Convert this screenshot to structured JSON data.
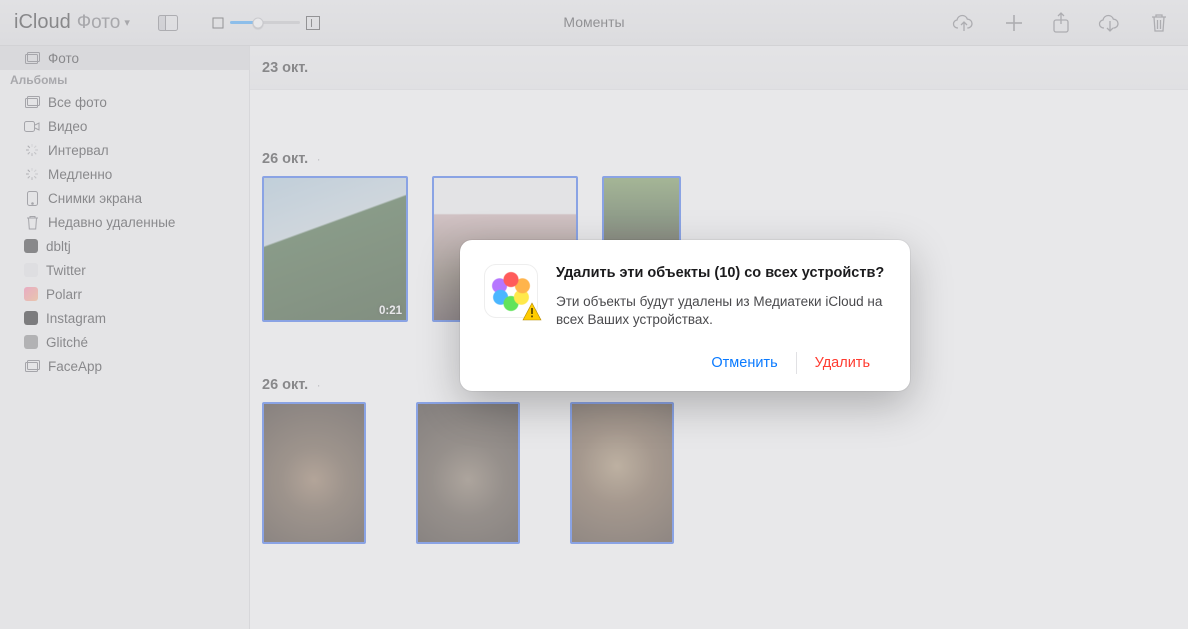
{
  "toolbar": {
    "app_name": "iCloud",
    "section": "Фото",
    "title": "Моменты",
    "zoom_percent": 40
  },
  "sidebar": {
    "top": {
      "label": "Фото"
    },
    "albums_header": "Альбомы",
    "items": [
      {
        "label": "Все фото",
        "icon": "stack"
      },
      {
        "label": "Видео",
        "icon": "video"
      },
      {
        "label": "Интервал",
        "icon": "spinner"
      },
      {
        "label": "Медленно",
        "icon": "spinner"
      },
      {
        "label": "Снимки экрана",
        "icon": "device"
      },
      {
        "label": "Недавно удаленные",
        "icon": "trash"
      },
      {
        "label": "dbltj",
        "icon": "thumb",
        "tone": "dark"
      },
      {
        "label": "Twitter",
        "icon": "thumb",
        "tone": "light"
      },
      {
        "label": "Polarr",
        "icon": "thumb",
        "tone": "pink"
      },
      {
        "label": "Instagram",
        "icon": "thumb",
        "tone": "black"
      },
      {
        "label": "Glitché",
        "icon": "thumb",
        "tone": "grey"
      },
      {
        "label": "FaceApp",
        "icon": "stack"
      }
    ]
  },
  "sections": [
    {
      "date": "23 окт."
    },
    {
      "date": "26 окт.",
      "marker": "·",
      "thumbs": [
        {
          "kind": "tree",
          "size": "t150",
          "duration": "0:21"
        },
        {
          "kind": "closet",
          "size": "t150"
        },
        {
          "kind": "garden",
          "size": "t80"
        }
      ]
    },
    {
      "date": "26 окт.",
      "marker": "·",
      "thumbs": [
        {
          "kind": "cat1",
          "size": "tport"
        },
        {
          "kind": "cat2",
          "size": "tport"
        },
        {
          "kind": "cat3",
          "size": "tport"
        }
      ]
    }
  ],
  "dialog": {
    "title": "Удалить эти объекты (10) со всех устройств?",
    "desc": "Эти объекты будут удалены из Медиатеки iCloud на всех Ваших устройствах.",
    "cancel": "Отменить",
    "delete": "Удалить"
  }
}
